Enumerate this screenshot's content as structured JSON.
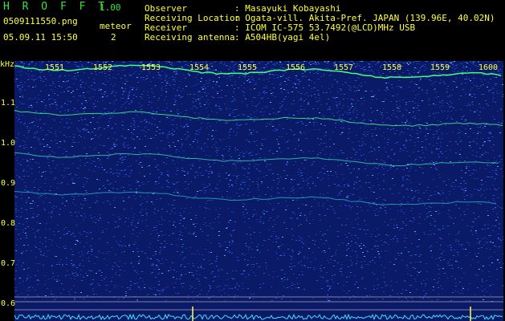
{
  "app": {
    "name": "H R O F F T",
    "version": "1.00"
  },
  "file": {
    "name": "0509111550.png",
    "datetime": "05.09.11 15:50"
  },
  "meteor": {
    "label": "meteor",
    "count": "2"
  },
  "info": [
    {
      "key": "Observer",
      "value": ": Masayuki Kobayashi"
    },
    {
      "key": "Receiving Location",
      "value": ": Ogata-vill. Akita-Pref. JAPAN (139.96E, 40.02N)"
    },
    {
      "key": "Receiver",
      "value": ": ICOM IC-575 53.7492(@LCD)MHz USB"
    },
    {
      "key": "Receiving antenna",
      "value": ": A504HB(yagi 4el)"
    }
  ],
  "chart_data": {
    "type": "heatmap",
    "ylabel": "kHz",
    "y_ticks": [
      "1.1",
      "1.0",
      "0.9",
      "0.8",
      "0.7",
      "0.6"
    ],
    "x_ticks": [
      "1551",
      "1552",
      "1553",
      "1554",
      "1555",
      "1556",
      "1557",
      "1558",
      "1559",
      "1600"
    ],
    "colors": {
      "bg": "#0a1a66",
      "noise": "#2040c0",
      "echo": "#40ff80",
      "baseline": "#40e0ff"
    }
  }
}
